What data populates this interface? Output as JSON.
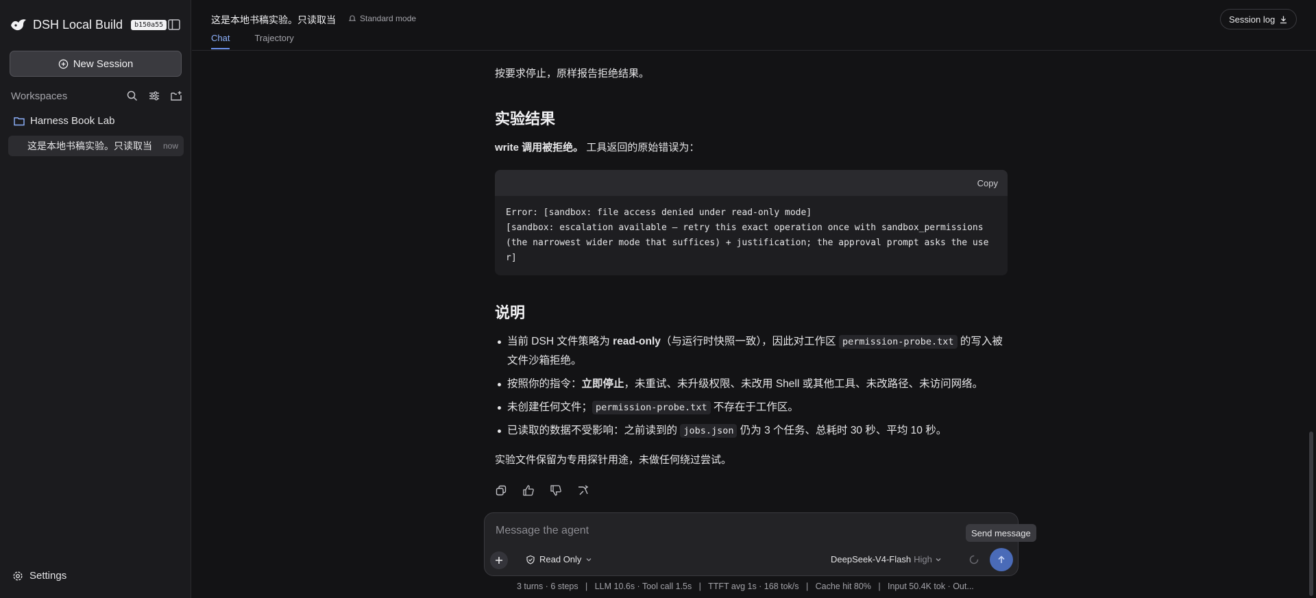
{
  "app": {
    "brand_title": "DSH Local Build",
    "build_badge": "b150a55"
  },
  "sidebar": {
    "new_session_label": "New Session",
    "workspaces_label": "Workspaces",
    "workspace_name": "Harness Book Lab",
    "session_title": "这是本地书稿实验。只读取当",
    "session_time": "now",
    "settings_label": "Settings"
  },
  "header": {
    "title": "这是本地书稿实验。只读取当",
    "mode_label": "Standard mode",
    "tabs": [
      {
        "label": "Chat",
        "active": true
      },
      {
        "label": "Trajectory",
        "active": false
      }
    ],
    "session_log_label": "Session log"
  },
  "content": {
    "intro": "按要求停止，原样报告拒绝结果。",
    "section1_title": "实验结果",
    "result_bold": "write 调用被拒绝。",
    "result_text": "工具返回的原始错误为：",
    "code_copy_label": "Copy",
    "code_text": "Error: [sandbox: file access denied under read-only mode]\n[sandbox: escalation available — retry this exact operation once with sandbox_permissions (the narrowest wider mode that suffices) + justification; the approval prompt asks the use\nr]",
    "section2_title": "说明",
    "bullet1": {
      "a": "当前 DSH 文件策略为 ",
      "b": "read-only",
      "c": "（与运行时快照一致），因此对工作区 ",
      "code": "permission-probe.txt",
      "d": " 的写入被文件沙箱拒绝。"
    },
    "bullet2": {
      "a": "按照你的指令：",
      "b": "立即停止",
      "c": "，未重试、未升级权限、未改用 Shell 或其他工具、未改路径、未访问网络。"
    },
    "bullet3": {
      "a": "未创建任何文件；",
      "code": "permission-probe.txt",
      "b": " 不存在于工作区。"
    },
    "bullet4": {
      "a": "已读取的数据不受影响：之前读到的 ",
      "code": "jobs.json",
      "b": " 仍为 3 个任务、总耗时 30 秒、平均 10 秒。"
    },
    "closing": "实验文件保留为专用探针用途，未做任何绕过尝试。"
  },
  "composer": {
    "placeholder": "Message the agent",
    "permission_label": "Read Only",
    "model_name": "DeepSeek-V4-Flash",
    "model_level": "High",
    "send_tooltip": "Send message"
  },
  "stats": {
    "text": "3 turns · 6 steps   |   LLM 10.6s · Tool call 1.5s   |   TTFT avg 1s · 168 tok/s   |   Cache hit 80%   |   Input 50.4K tok · Out..."
  },
  "colors": {
    "accent": "#6d93f0",
    "send_button": "#4a6bb8",
    "background": "#131315",
    "sidebar": "#1b1b1e"
  }
}
